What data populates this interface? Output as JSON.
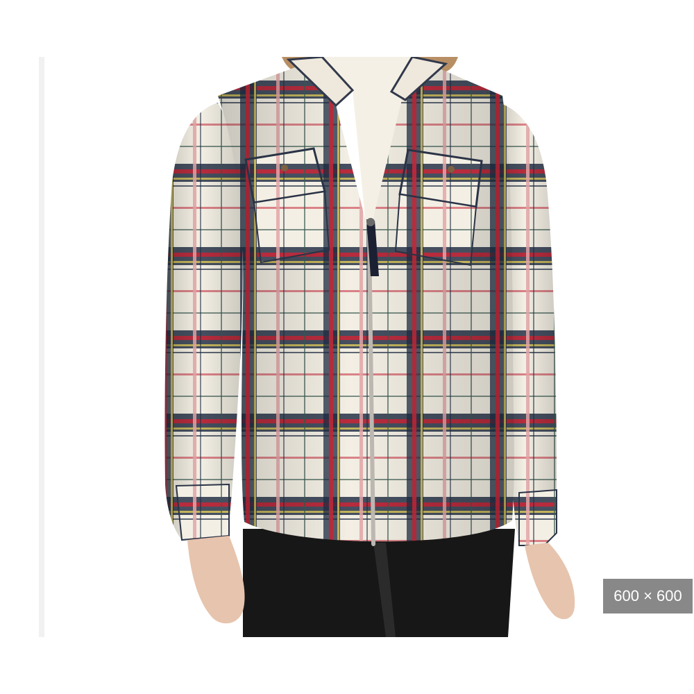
{
  "image_viewer": {
    "product_image_icon": "plaid-zip-shirt-image",
    "dimensions_label": "600 × 600",
    "colors": {
      "background": "#ffffff",
      "badge_background": "#888888",
      "badge_text": "#ffffff",
      "plaid_cream": "#f3efe4",
      "plaid_navy": "#1f2c43",
      "plaid_red": "#c4283a",
      "plaid_green": "#3b5a50",
      "plaid_yellow": "#d8c45a",
      "pants": "#171717",
      "skin": "#e7c4ad"
    }
  }
}
